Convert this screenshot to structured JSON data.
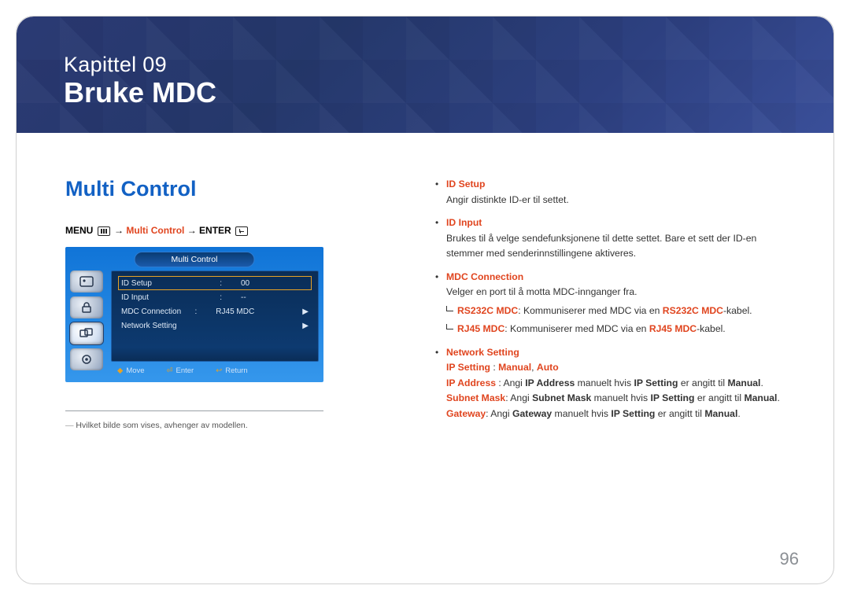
{
  "chapter": {
    "pre": "Kapittel  09",
    "title": "Bruke MDC"
  },
  "section_title": "Multi Control",
  "menupath": {
    "menu_word": "MENU",
    "mid": "Multi Control",
    "enter_word": "ENTER",
    "arrow": " → "
  },
  "osd": {
    "title": "Multi Control",
    "rows": [
      {
        "label": "ID Setup",
        "value": "00",
        "arrow": "",
        "selected": true
      },
      {
        "label": "ID Input",
        "value": "--",
        "arrow": ""
      },
      {
        "label": "MDC Connection",
        "value": "RJ45 MDC",
        "arrow": "▶"
      },
      {
        "label": "Network Setting",
        "value": "",
        "arrow": "▶"
      }
    ],
    "footer": [
      {
        "key": "◆",
        "label": "Move"
      },
      {
        "key": "⏎",
        "label": "Enter"
      },
      {
        "key": "↩",
        "label": "Return"
      }
    ]
  },
  "note": "Hvilket bilde som vises, avhenger av modellen.",
  "right": {
    "id_setup": {
      "heading": "ID Setup",
      "body": "Angir distinkte ID-er til settet."
    },
    "id_input": {
      "heading": "ID Input",
      "body": "Brukes til å velge sendefunksjonene til dette settet. Bare et sett der ID-en stemmer med senderinnstillingene aktiveres."
    },
    "mdc_conn": {
      "heading": "MDC Connection",
      "body": "Velger en port til å motta MDC-innganger fra.",
      "sub1_k1": "RS232C MDC",
      "sub1_mid": ": Kommuniserer med MDC via en ",
      "sub1_k2": "RS232C MDC",
      "sub1_tail": "-kabel.",
      "sub2_k1": "RJ45 MDC",
      "sub2_mid": ": Kommuniserer med MDC via en ",
      "sub2_k2": "RJ45 MDC",
      "sub2_tail": "-kabel."
    },
    "network": {
      "heading": "Network Setting",
      "line1_a": "IP Setting",
      "line1_b": " : ",
      "line1_c": "Manual",
      "line1_d": ", ",
      "line1_e": "Auto",
      "ip_addr_a": "IP Address",
      "ip_addr_b": " : Angi ",
      "ip_addr_c": "IP Address",
      "ip_addr_d": " manuelt hvis ",
      "ip_addr_e": "IP Setting",
      "ip_addr_f": " er angitt til ",
      "ip_addr_g": "Manual",
      "ip_addr_h": ".",
      "sm_a": "Subnet Mask",
      "sm_b": ": Angi ",
      "sm_c": "Subnet Mask",
      "sm_d": " manuelt hvis ",
      "sm_e": "IP Setting",
      "sm_f": " er angitt til ",
      "sm_g": "Manual",
      "sm_h": ".",
      "gw_a": "Gateway",
      "gw_b": ": Angi ",
      "gw_c": "Gateway",
      "gw_d": " manuelt hvis ",
      "gw_e": "IP Setting",
      "gw_f": " er angitt til ",
      "gw_g": "Manual",
      "gw_h": "."
    }
  },
  "page_number": "96"
}
